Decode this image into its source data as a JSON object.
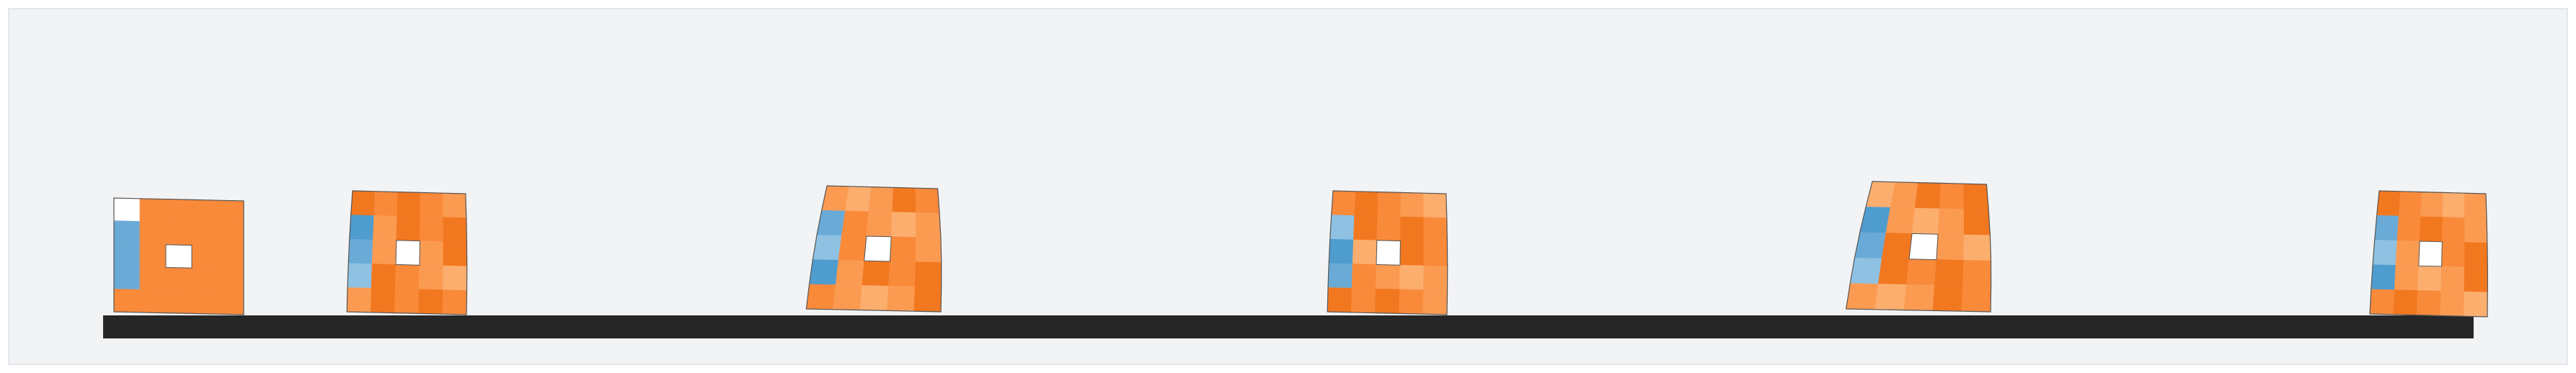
{
  "scene": {
    "background_color": "#ffffff",
    "panel_color": "#f2f3f5",
    "panel_border_color": "#e4e6ea",
    "ground_color": "#262626",
    "palette": {
      "orange_dark": "#f27820",
      "orange_mid": "#f98a3a",
      "orange_light": "#fb9b52",
      "orange_pale": "#fcae6e",
      "blue_dark": "#4f9ccf",
      "blue_mid": "#6aaad6",
      "blue_light": "#8fc1e2",
      "outline": "#555555"
    }
  },
  "robots": [
    {
      "frame": 1,
      "pose": "initial-rest",
      "actuated_side": "left"
    },
    {
      "frame": 2,
      "pose": "compressed",
      "actuated_side": "left"
    },
    {
      "frame": 3,
      "pose": "leaning",
      "actuated_side": "left"
    },
    {
      "frame": 4,
      "pose": "compressed",
      "actuated_side": "left"
    },
    {
      "frame": 5,
      "pose": "stretched",
      "actuated_side": "left"
    },
    {
      "frame": 6,
      "pose": "compressed",
      "actuated_side": "left"
    }
  ]
}
